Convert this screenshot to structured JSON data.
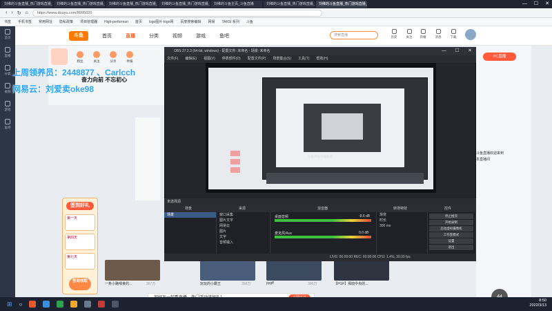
{
  "browser": {
    "tabs": [
      "刘维的斗鱼直播_热门游戏直播_斗鱼",
      "刘维的斗鱼直播_热门游戏直播_斗鱼",
      "刘维的斗鱼直播_热门游戏直播_斗鱼",
      "刘维的斗鱼直播_热门游戏直播_斗鱼",
      "刘维的斗鱼主页_斗鱼直播",
      "刘维的斗鱼直播_热门游戏直播_斗鱼",
      "刘维的斗鱼直播_热门游戏直播_斗鱼"
    ],
    "url": "https://www.douyu.com/8995020",
    "bookmarks": [
      "书签",
      "手机书签",
      "常用网址",
      "隐私政策",
      "项目管理器",
      "High-performan",
      "首页",
      "logo图片-logo网",
      "百度搜索编辑",
      "网易",
      "TAKSI 系列",
      "斗鱼"
    ]
  },
  "rail": [
    "首页",
    "直播",
    "分类",
    "视频",
    "游戏",
    "鱼吧"
  ],
  "nav": {
    "logo": "斗鱼",
    "links": [
      "首页",
      "直播",
      "分类",
      "视频",
      "游戏",
      "鱼吧"
    ],
    "search_placeholder": "搜索直播",
    "icons": [
      "历史",
      "关注",
      "开播",
      "消息",
      "下载"
    ]
  },
  "room": {
    "rh_icons": [
      "粉丝",
      "关注",
      "分享",
      "举报"
    ],
    "overlay_line1": "上周领养员：2448877 、Carlcch",
    "overlay_line2": "网易云：刘爱卖oke98",
    "slogan": "奋力向前 不忘初心",
    "sign_title": "签到好礼",
    "sign_days": [
      "第一天",
      "第四天",
      "第七天"
    ],
    "sign_btn": "签到领取",
    "pc_btn": "PC直播",
    "right_text": "斗鱼直播欢迎来到本直播间",
    "toast": "加好友一起看直播，热门活动送好礼！",
    "toast_btn": "立即关注",
    "float_badge": "44"
  },
  "tiles": [
    {
      "caption": "一条小路喂食的...",
      "stat": "367万"
    },
    {
      "caption": "玩玩的小霸王",
      "stat": "358万"
    },
    {
      "caption": "pygff",
      "stat": "300万"
    },
    {
      "caption": "【PGF】揭晓中央的...",
      "stat": ""
    }
  ],
  "obs": {
    "title": "OBS 27.2.3 (64-bit, windows) - 配置文件: 未命名 - 场景: 未命名",
    "menu": [
      "文件(F)",
      "编辑(E)",
      "视图(V)",
      "停靠部件(D)",
      "配置文件(P)",
      "场景集合(S)",
      "工具(T)",
      "帮助(H)"
    ],
    "preview_label": "斗鱼平台开播教程",
    "toolbar": "未选择源",
    "dock_titles": [
      "场景",
      "来源",
      "混音器",
      "转场特效",
      "控件"
    ],
    "scenes": [
      "场景"
    ],
    "sources": [
      "窗口采集",
      "图片文字",
      "网易云",
      "图片",
      "文字",
      "音频输入"
    ],
    "mixer": [
      {
        "name": "桌面音频",
        "db": "-8.6 dB"
      },
      {
        "name": "麦克风/Aux",
        "db": "0.0 dB"
      }
    ],
    "transition": {
      "type": "渐变",
      "duration_label": "时长",
      "duration": "300 ms"
    },
    "controls": [
      "停止推流",
      "开始录制",
      "启动虚拟摄像机",
      "工作室模式",
      "设置",
      "退出"
    ],
    "status": "LIVE: 00:00:00   REC: 00:00:00   CPU: 1.4%, 30.00 fps"
  },
  "taskbar": {
    "clock_time": "8:50",
    "clock_date": "2022/3/13"
  },
  "colors": {
    "accent": "#ff5d23",
    "obs_bg": "#24262b",
    "overlay_text": "#2aa3ff"
  }
}
